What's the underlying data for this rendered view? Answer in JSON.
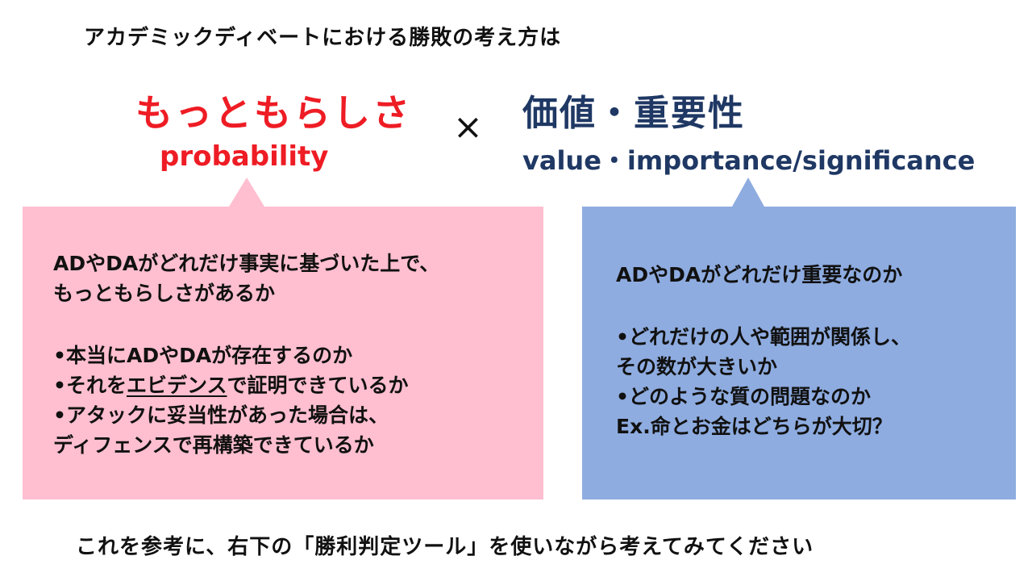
{
  "colors": {
    "left_accent": "#ee1c24",
    "right_accent": "#1f3864",
    "left_box": "#ffbfd0",
    "right_box": "#8eace0"
  },
  "header": {
    "title": "アカデミックディベートにおける勝敗の考え方は"
  },
  "left": {
    "heading_jp": "もっともらしさ",
    "heading_en": "probability",
    "line1": "ADやDAがどれだけ事実に基づいた上で、",
    "line2": "もっともらしさがあるか",
    "bullet1": "•本当にADやDAが存在するのか",
    "bullet2_pre": "•それを",
    "bullet2_underlined": "エビデンス",
    "bullet2_post": "で証明できているか",
    "bullet3": "•アタックに妥当性があった場合は、",
    "bullet3_cont": "ディフェンスで再構築できているか"
  },
  "operator": "×",
  "right": {
    "heading_jp": "価値・重要性",
    "heading_en": "value・importance/significance",
    "line1": "ADやDAがどれだけ重要なのか",
    "bullet1": "•どれだけの人や範囲が関係し、",
    "bullet1_cont": "その数が大きいか",
    "bullet2": "•どのような質の問題なのか",
    "example": "Ex.命とお金はどちらが大切？"
  },
  "footer": {
    "text": "これを参考に、右下の「勝利判定ツール」を使いながら考えてみてください"
  }
}
